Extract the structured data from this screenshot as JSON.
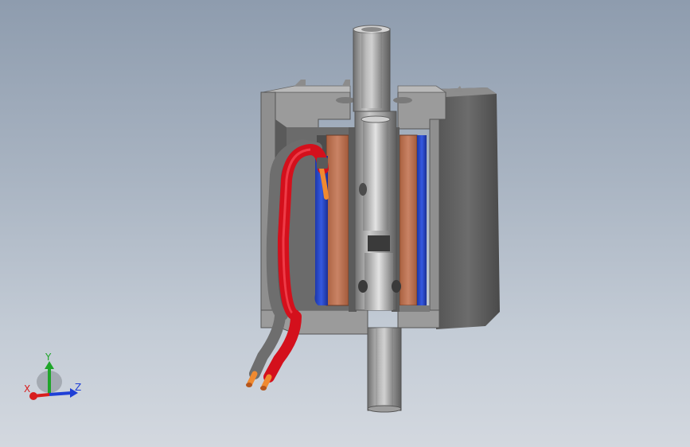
{
  "triad": {
    "x_label": "X",
    "y_label": "Y",
    "z_label": "Z",
    "x_color": "#d81e1e",
    "y_color": "#1fa52a",
    "z_color": "#1f3fd6"
  },
  "colors": {
    "background_top": "#8e9cae",
    "background_bottom": "#d3d8df",
    "housing": "#7d7d7d",
    "copper": "#c07656",
    "blue_coil": "#2746c9",
    "red_wire": "#d4101c",
    "orange_wire": "#f08a30",
    "shaft": "#a6a6a6"
  }
}
